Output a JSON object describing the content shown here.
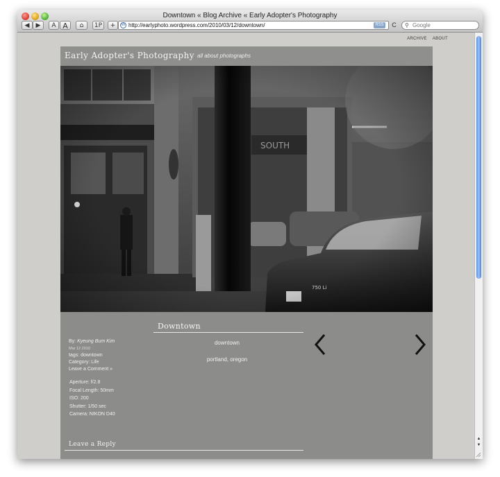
{
  "window": {
    "title": "Downtown « Blog Archive « Early Adopter's Photography",
    "url": "http://earlyphoto.wordpress.com/2010/03/12/downtown/",
    "rss_label": "RSS",
    "search_placeholder": "Google",
    "toolbar": {
      "back": "◀",
      "forward": "▶",
      "text_smaller": "A",
      "text_bigger": "A",
      "home": "⌂",
      "onepassword": "1P",
      "add_bookmark": "+",
      "reload": "C"
    }
  },
  "topnav": {
    "archive": "ARCHIVE",
    "about": "ABOUT"
  },
  "site": {
    "title": "Early Adopter's Photography",
    "tagline": "all about photographs"
  },
  "post": {
    "title": "Downtown",
    "byline_prefix": "By:",
    "author": "Kyeung Bum Kim",
    "date": "Mar 12 2010",
    "tags": "tags: downtown",
    "category": "Category: Life",
    "comment_link": "Leave a Comment »",
    "center_title": "downtown",
    "center_location": "portland, oregon",
    "exif": {
      "aperture": "Aperture:  f/2.8",
      "focal_length": "Focal Length:  50mm",
      "iso": "ISO:  200",
      "shutter": "Shutter:  1/50 sec",
      "camera": "Camera:  NIKON D40"
    }
  },
  "reply": {
    "heading": "Leave a Reply"
  },
  "colors": {
    "page_background": "#cfcecb",
    "content_panel": "#8c8c8a",
    "text": "#f0f0f0"
  }
}
